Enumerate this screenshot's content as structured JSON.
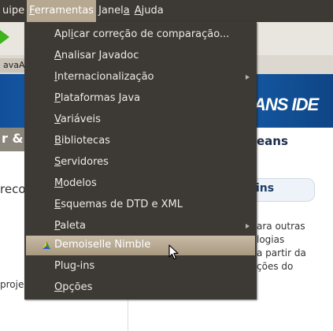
{
  "menubar": {
    "items": [
      {
        "text": "uipe",
        "mnemonic": "",
        "rest": "",
        "active": false
      },
      {
        "pre": "",
        "mnemonic": "F",
        "rest": "erramentas",
        "active": true
      },
      {
        "pre": "Janel",
        "mnemonic": "a",
        "rest": "",
        "active": false
      },
      {
        "pre": "",
        "mnemonic": "A",
        "rest": "juda",
        "active": false
      }
    ]
  },
  "background": {
    "tab_label": "avaA",
    "banner_logo": "ANS IDE",
    "left_strip_text": "r &",
    "right_heading": "eans",
    "left_text_1": "reco",
    "pill_text": "ins",
    "right_text": [
      "ara outras",
      "logias",
      "a partir da",
      "ções do"
    ],
    "left_text_2": "proje"
  },
  "menu": {
    "items": [
      {
        "pre": "Apl",
        "mn": "i",
        "post": "car correção de comparação...",
        "submenu": false
      },
      {
        "pre": "",
        "mn": "A",
        "post": "nalisar Javadoc",
        "submenu": false
      },
      {
        "pre": "",
        "mn": "I",
        "post": "nternacionalização",
        "submenu": true
      },
      {
        "pre": "",
        "mn": "P",
        "post": "lataformas Java",
        "submenu": false
      },
      {
        "pre": "",
        "mn": "V",
        "post": "ariáveis",
        "submenu": false
      },
      {
        "pre": "",
        "mn": "B",
        "post": "ibliotecas",
        "submenu": false
      },
      {
        "pre": "",
        "mn": "S",
        "post": "ervidores",
        "submenu": false
      },
      {
        "pre": "",
        "mn": "M",
        "post": "odelos",
        "submenu": false
      },
      {
        "pre": "",
        "mn": "E",
        "post": "squemas de DTD e XML",
        "submenu": false
      },
      {
        "pre": "",
        "mn": "P",
        "post": "aleta",
        "submenu": true
      },
      {
        "pre": "Demoiselle Nimble",
        "mn": "",
        "post": "",
        "submenu": false
      },
      {
        "pre": "Plu",
        "mn": "g",
        "post": "-ins",
        "submenu": false
      },
      {
        "pre": "",
        "mn": "O",
        "post": "pções",
        "submenu": false
      }
    ]
  },
  "colors": {
    "menu_bg": "#3d3a36",
    "menu_text": "#eeeae2",
    "highlight": "#b7a891",
    "banner": "#1c6fc4"
  }
}
